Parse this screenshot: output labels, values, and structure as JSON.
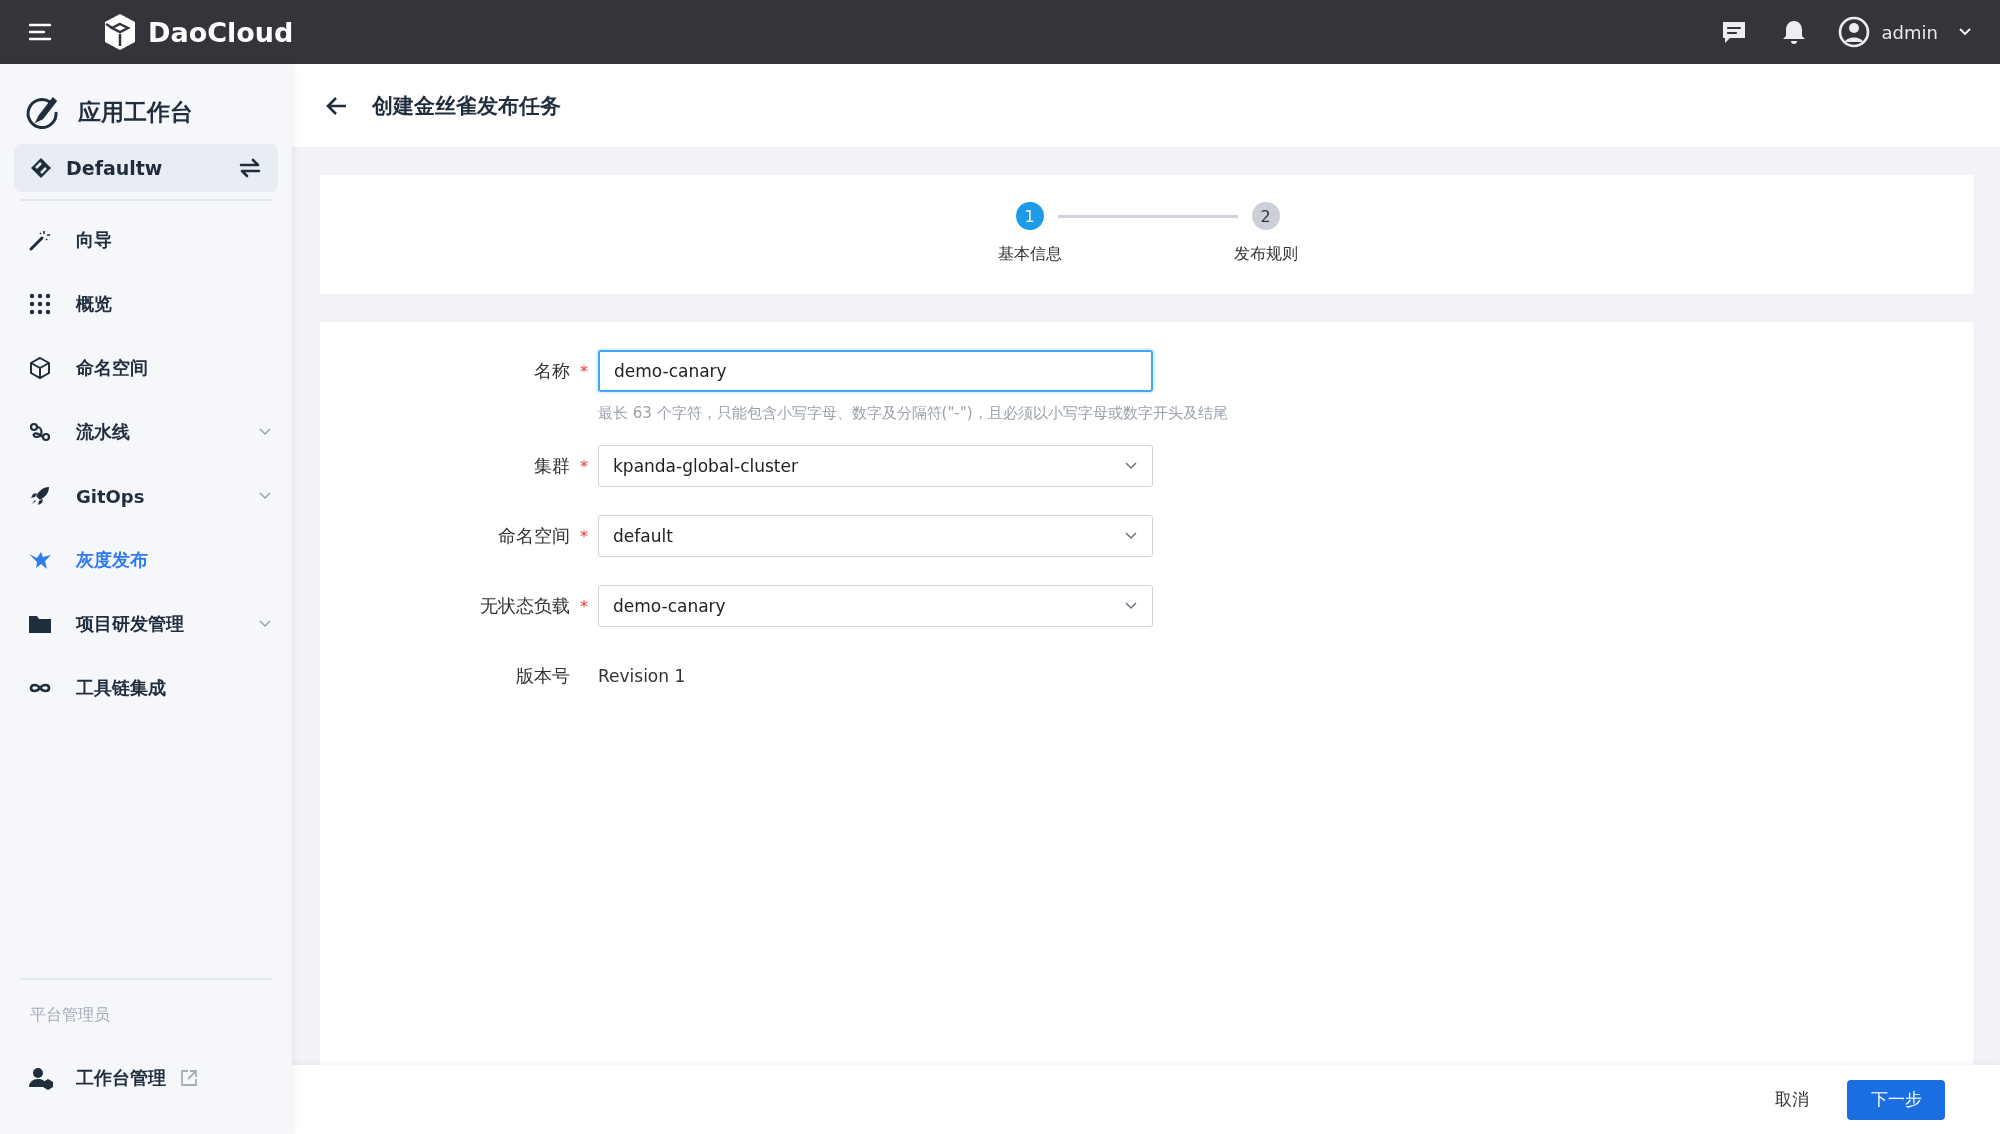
{
  "topbar": {
    "brand": "DaoCloud",
    "user": "admin"
  },
  "sidebar": {
    "title": "应用工作台",
    "workspace": "Defaultw",
    "items": [
      {
        "label": "向导",
        "selected": false,
        "expandable": false
      },
      {
        "label": "概览",
        "selected": false,
        "expandable": false
      },
      {
        "label": "命名空间",
        "selected": false,
        "expandable": false
      },
      {
        "label": "流水线",
        "selected": false,
        "expandable": true
      },
      {
        "label": "GitOps",
        "selected": false,
        "expandable": true
      },
      {
        "label": "灰度发布",
        "selected": true,
        "expandable": false
      },
      {
        "label": "项目研发管理",
        "selected": false,
        "expandable": true
      },
      {
        "label": "工具链集成",
        "selected": false,
        "expandable": false
      }
    ],
    "section": "平台管理员",
    "admin_item": {
      "label": "工作台管理",
      "external": true
    }
  },
  "page": {
    "title": "创建金丝雀发布任务"
  },
  "steps": [
    {
      "number": "1",
      "label": "基本信息",
      "selected": true
    },
    {
      "number": "2",
      "label": "发布规则",
      "selected": false
    }
  ],
  "form": [
    {
      "kind": "input",
      "label": "名称",
      "required_mark": "*",
      "focused": true,
      "value": "demo-canary",
      "hint": "最长 63 个字符，只能包含小写字母、数字及分隔符(\"-\")，且必须以小写字母或数字开头及结尾"
    },
    {
      "kind": "select",
      "label": "集群",
      "required_mark": "*",
      "value": "kpanda-global-cluster"
    },
    {
      "kind": "select",
      "label": "命名空间",
      "required_mark": "*",
      "value": "default"
    },
    {
      "kind": "select",
      "label": "无状态负载",
      "required_mark": "*",
      "value": "demo-canary"
    },
    {
      "kind": "text",
      "label": "版本号",
      "value": "Revision 1"
    }
  ],
  "footer": {
    "cancel": "取消",
    "next": "下一步"
  }
}
